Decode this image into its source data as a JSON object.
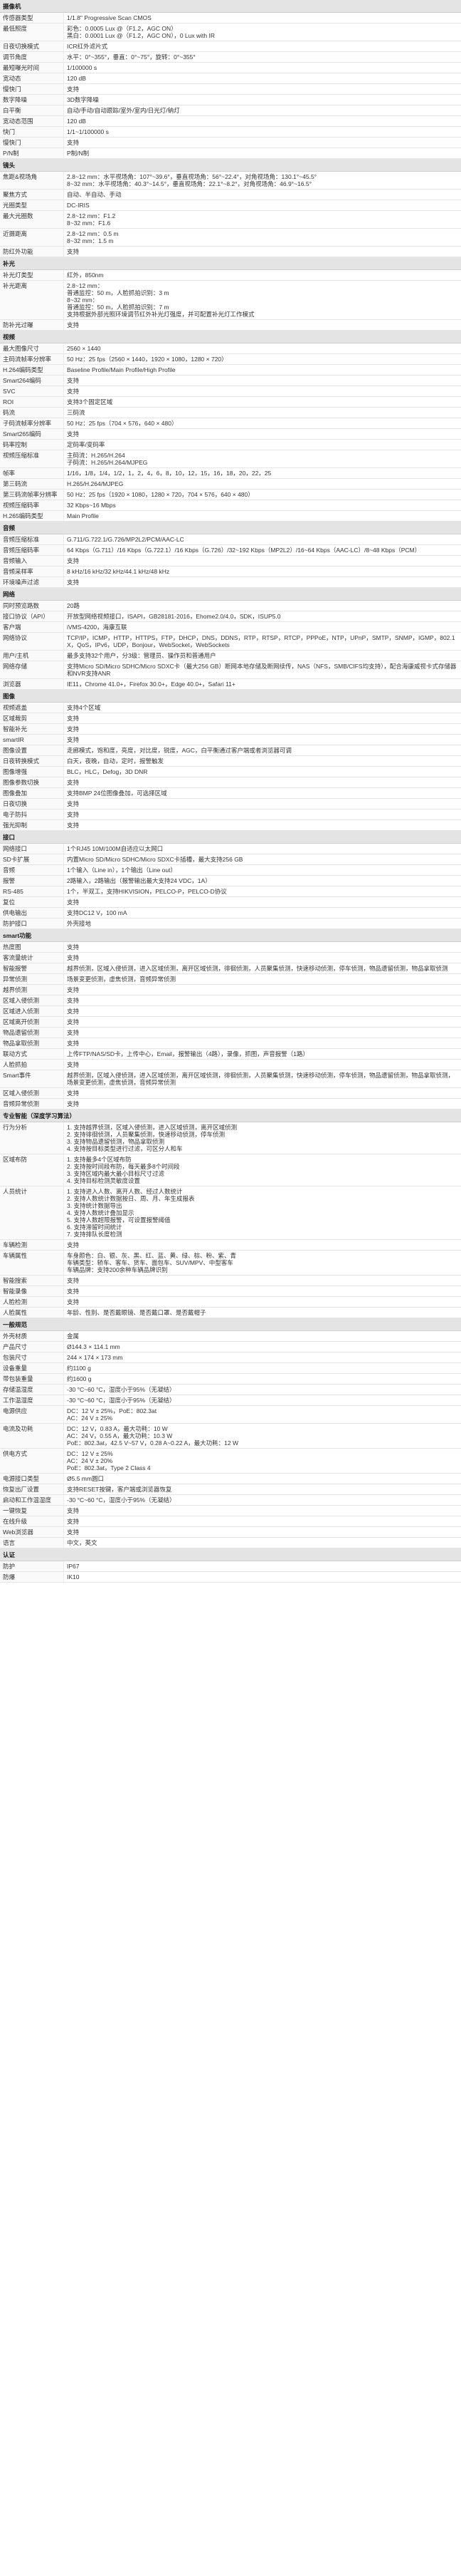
{
  "sections": [
    {
      "title": "摄像机",
      "rows": [
        [
          "传感器类型",
          "1/1.8\" Progressive Scan CMOS"
        ],
        [
          "最低照度",
          "彩色：0.0005 Lux @（F1.2，AGC ON）\n黑白：0.0001 Lux @（F1.2，AGC ON），0 Lux with IR"
        ],
        [
          "日夜切换模式",
          "ICR红外滤片式"
        ],
        [
          "调节角度",
          "水平：0°~355°，垂直：0°~75°，旋转：0°~355°"
        ],
        [
          "最短曝光时间",
          "1/100000 s"
        ],
        [
          "宽动态",
          "120 dB"
        ],
        [
          "慢快门",
          "支持"
        ],
        [
          "数字降噪",
          "3D数字降噪"
        ],
        [
          "白平衡",
          "自动/手动/自动跟踪/室外/室内/日光灯/钠灯"
        ],
        [
          "宽动态范围",
          "120 dB"
        ],
        [
          "快门",
          "1/1~1/100000 s"
        ],
        [
          "慢快门",
          "支持"
        ],
        [
          "P/N制",
          "P制/N制"
        ]
      ]
    },
    {
      "title": "镜头",
      "rows": [
        [
          "焦距&视场角",
          "2.8~12 mm：水平视场角：107°~39.6°，垂直视场角：56°~22.4°，对角视场角：130.1°~45.5°\n8~32 mm：水平视场角：40.3°~14.5°，垂直视场角：22.1°~8.2°，对角视场角：46.9°~16.5°"
        ],
        [
          "聚焦方式",
          "自动、半自动、手动"
        ],
        [
          "光圈类型",
          "DC-IRIS"
        ],
        [
          "最大光圈数",
          "2.8~12 mm：F1.2\n8~32 mm：F1.6"
        ],
        [
          "近摄距离",
          "2.8~12 mm：0.5 m\n8~32 mm：1.5 m"
        ],
        [
          "防红外功能",
          "支持"
        ]
      ]
    },
    {
      "title": "补光",
      "rows": [
        [
          "补光灯类型",
          "红外，850nm"
        ],
        [
          "补光距离",
          "2.8~12 mm：\n普通监控：50 m，人脸抓拍识别：3 m\n8~32 mm：\n普通监控：50 m，人脸抓拍识别：7 m\n支持根据外部光照环境调节红外补光灯强度，并可配置补光灯工作模式"
        ],
        [
          "防补光过曝",
          "支持"
        ]
      ]
    },
    {
      "title": "视频",
      "rows": [
        [
          "最大图像尺寸",
          "2560 × 1440"
        ],
        [
          "主码流帧率分辨率",
          "50 Hz：25 fps（2560 × 1440，1920 × 1080，1280 × 720）"
        ],
        [
          "H.264编码类型",
          "Baseline Profile/Main Profile/High Profile"
        ],
        [
          "Smart264编码",
          "支持"
        ],
        [
          "SVC",
          "支持"
        ],
        [
          "ROI",
          "支持3个固定区域"
        ],
        [
          "码流",
          "三码流"
        ],
        [
          "子码流帧率分辨率",
          "50 Hz：25 fps（704 × 576，640 × 480）"
        ],
        [
          "Smart265编码",
          "支持"
        ],
        [
          "码率控制",
          "定码率/变码率"
        ],
        [
          "视频压缩标准",
          "主码流：H.265/H.264\n子码流：H.265/H.264/MJPEG"
        ],
        [
          "帧率",
          "1/16，1/8，1/4，1/2，1，2，4，6，8，10，12，15，16，18，20，22，25"
        ],
        [
          "第三码流",
          "H.265/H.264/MJPEG"
        ],
        [
          "第三码流帧率分辨率",
          "50 Hz：25 fps（1920 × 1080，1280 × 720，704 × 576，640 × 480）"
        ],
        [
          "视频压缩码率",
          "32 Kbps~16 Mbps"
        ],
        [
          "H.265编码类型",
          "Main Profile"
        ]
      ]
    },
    {
      "title": "音频",
      "rows": [
        [
          "音频压缩标准",
          "G.711/G.722.1/G.726/MP2L2/PCM/AAC-LC"
        ],
        [
          "音频压缩码率",
          "64 Kbps（G.711）/16 Kbps（G.722.1）/16 Kbps（G.726）/32~192 Kbps（MP2L2）/16~64 Kbps（AAC-LC）/8~48 Kbps（PCM）"
        ],
        [
          "音频输入",
          "支持"
        ],
        [
          "音频采样率",
          "8 kHz/16 kHz/32 kHz/44.1 kHz/48 kHz"
        ],
        [
          "环境噪声过滤",
          "支持"
        ]
      ]
    },
    {
      "title": "网络",
      "rows": [
        [
          "同时预览路数",
          "20路"
        ],
        [
          "接口协议（API）",
          "开放型网络视频接口，ISAPI，GB28181-2016，Ehome2.0/4.0，SDK，ISUP5.0"
        ],
        [
          "客户端",
          "iVMS-4200，海康互联"
        ],
        [
          "网络协议",
          "TCP/IP，ICMP，HTTP，HTTPS，FTP，DHCP，DNS，DDNS，RTP，RTSP，RTCP，PPPoE，NTP，UPnP，SMTP，SNMP，IGMP，802.1X，QoS，IPv6，UDP，Bonjour，WebSocket，WebSockets"
        ],
        [
          "用户/主机",
          "最多支持32个用户，分3级：管理员、操作员和普通用户"
        ],
        [
          "网络存储",
          "支持Micro SD/Micro SDHC/Micro SDXC卡（最大256 GB）断网本地存储及断网续传，NAS（NFS，SMB/CIFS均支持），配合海康威视卡式存储器和NVR支持ANR"
        ],
        [
          "浏览器",
          "IE11，Chrome 41.0+，Firefox 30.0+，Edge 40.0+，Safari 11+"
        ]
      ]
    },
    {
      "title": "图像",
      "rows": [
        [
          "视频遮盖",
          "支持4个区域"
        ],
        [
          "区域裁剪",
          "支持"
        ],
        [
          "智能补光",
          "支持"
        ],
        [
          "smartIR",
          "支持"
        ],
        [
          "图像设置",
          "走廊模式，饱和度，亮度，对比度，锐度，AGC，白平衡通过客户端或者浏览器可调"
        ],
        [
          "日夜转换模式",
          "白天，夜晚，自动，定时，报警触发"
        ],
        [
          "图像增强",
          "BLC，HLC，Defog，3D DNR"
        ],
        [
          "图像参数切换",
          "支持"
        ],
        [
          "图像叠加",
          "支持BMP 24位图像叠加，可选择区域"
        ],
        [
          "日夜切换",
          "支持"
        ],
        [
          "电子防抖",
          "支持"
        ],
        [
          "强光抑制",
          "支持"
        ]
      ]
    },
    {
      "title": "接口",
      "rows": [
        [
          "网络接口",
          "1个RJ45 10M/100M自适应以太网口"
        ],
        [
          "SD卡扩展",
          "内置Micro SD/Micro SDHC/Micro SDXC卡插槽，最大支持256 GB"
        ],
        [
          "音频",
          "1个输入（Line in），1个输出（Line out）"
        ],
        [
          "报警",
          "2路输入，2路输出（报警输出最大支持24 VDC，1A）"
        ],
        [
          "RS-485",
          "1个，半双工，支持HIKVISION，PELCO-P，PELCO-D协议"
        ],
        [
          "复位",
          "支持"
        ],
        [
          "供电输出",
          "支持DC12 V，100 mA"
        ],
        [
          "防护接口",
          "外壳接地"
        ]
      ]
    },
    {
      "title": "smart功能",
      "rows": [
        [
          "热度图",
          "支持"
        ],
        [
          "客流量统计",
          "支持"
        ],
        [
          "智能报警",
          "越界侦测，区域入侵侦测，进入区域侦测，离开区域侦测，徘徊侦测，人员聚集侦测，快速移动侦测，停车侦测，物品遗留侦测，物品拿取侦测"
        ],
        [
          "异常侦测",
          "场景变更侦测，虚焦侦测，音频异常侦测"
        ],
        [
          "越界侦测",
          "支持"
        ],
        [
          "区域入侵侦测",
          "支持"
        ],
        [
          "区域进入侦测",
          "支持"
        ],
        [
          "区域离开侦测",
          "支持"
        ],
        [
          "物品遗留侦测",
          "支持"
        ],
        [
          "物品拿取侦测",
          "支持"
        ],
        [
          "联动方式",
          "上传FTP/NAS/SD卡，上传中心，Email，报警输出（4路），录像，抓图，声音报警（1路）"
        ],
        [
          "人脸抓拍",
          "支持"
        ],
        [
          "Smart事件",
          "越界侦测，区域入侵侦测，进入区域侦测，离开区域侦测，徘徊侦测，人员聚集侦测，快速移动侦测，停车侦测，物品遗留侦测，物品拿取侦测，场景变更侦测，虚焦侦测，音频异常侦测"
        ],
        [
          "区域入侵侦测",
          "支持"
        ],
        [
          "音频异常侦测",
          "支持"
        ]
      ]
    },
    {
      "title": "专业智能（深度学习算法）",
      "rows": [
        [
          "行为分析",
          "1. 支持越界侦测，区域入侵侦测，进入区域侦测，离开区域侦测\n2. 支持徘徊侦测，人员聚集侦测，快速移动侦测，停车侦测\n3. 支持物品遗留侦测，物品拿取侦测\n4. 支持按目标类型进行过滤，可区分人和车"
        ],
        [
          "区域布防",
          "1. 支持最多4个区域布防\n2. 支持按时间段布防，每天最多8个时间段\n3. 支持区域内最大最小目标尺寸过滤\n4. 支持目标检测灵敏度设置"
        ],
        [
          "人员统计",
          "1. 支持进入人数、离开人数、经过人数统计\n2. 支持人数统计数据按日、周、月、年生成报表\n3. 支持统计数据导出\n4. 支持人数统计叠加显示\n5. 支持人数超限报警，可设置报警阈值\n6. 支持滞留时间统计\n7. 支持排队长度检测"
        ],
        [
          "车辆检测",
          "支持"
        ],
        [
          "车辆属性",
          "车身颜色：白、银、灰、黑、红、蓝、黄、绿、棕、粉、紫、青\n车辆类型：轿车、客车、货车、面包车、SUV/MPV、中型客车\n车辆品牌：支持200余种车辆品牌识别"
        ],
        [
          "智能搜索",
          "支持"
        ],
        [
          "智能录像",
          "支持"
        ],
        [
          "人脸检测",
          "支持"
        ],
        [
          "人脸属性",
          "年龄、性别、是否戴眼镜、是否戴口罩、是否戴帽子"
        ]
      ]
    },
    {
      "title": "一般规范",
      "rows": [
        [
          "外壳材质",
          "金属"
        ],
        [
          "产品尺寸",
          "Ø144.3 × 114.1 mm"
        ],
        [
          "包装尺寸",
          "244 × 174 × 173 mm"
        ],
        [
          "设备重量",
          "约1100 g"
        ],
        [
          "带包装重量",
          "约1600 g"
        ],
        [
          "存储温湿度",
          "-30 °C~60 °C，湿度小于95%（无凝结）"
        ],
        [
          "工作温湿度",
          "-30 °C~60 °C，湿度小于95%（无凝结）"
        ],
        [
          "电源供应",
          "DC：12 V ± 25%，PoE：802.3at\nAC：24 V ± 25%"
        ],
        [
          "电流及功耗",
          "DC：12 V，0.83 A，最大功耗：10 W\nAC：24 V，0.55 A，最大功耗：10.3 W\nPoE：802.3at，42.5 V~57 V，0.28 A~0.22 A，最大功耗：12 W"
        ],
        [
          "供电方式",
          "DC：12 V ± 25%\nAC：24 V ± 20%\nPoE：802.3at，Type 2 Class 4"
        ],
        [
          "电源接口类型",
          "Ø5.5 mm圆口"
        ],
        [
          "恢复出厂设置",
          "支持RESET按键，客户端或浏览器恢复"
        ],
        [
          "启动和工作温湿度",
          "-30 °C~60 °C，湿度小于95%（无凝结）"
        ],
        [
          "一键恢复",
          "支持"
        ],
        [
          "在线升级",
          "支持"
        ],
        [
          "Web浏览器",
          "支持"
        ],
        [
          "语言",
          "中文，英文"
        ]
      ]
    },
    {
      "title": "认证",
      "rows": [
        [
          "防护",
          "IP67"
        ],
        [
          "防爆",
          "IK10"
        ]
      ]
    }
  ]
}
